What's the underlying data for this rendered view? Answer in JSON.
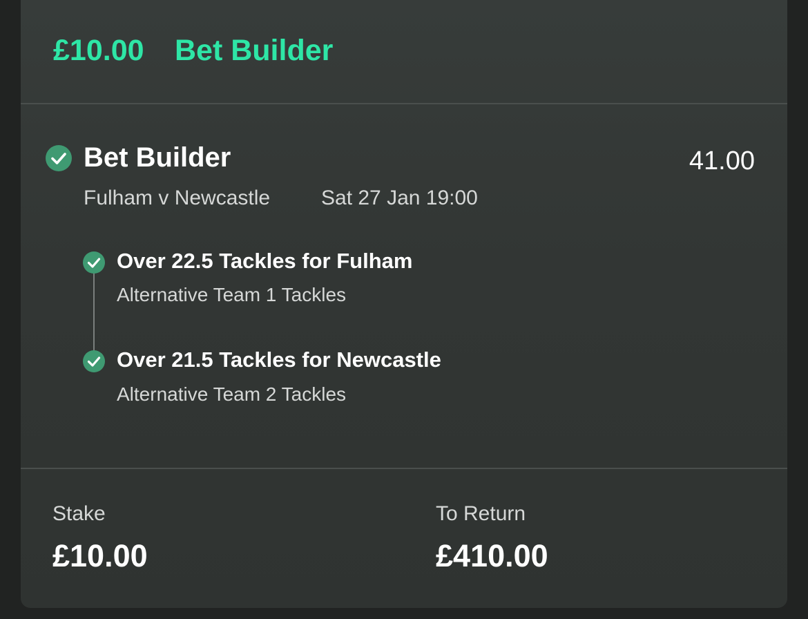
{
  "header": {
    "amount": "£10.00",
    "bet_type": "Bet Builder"
  },
  "selection": {
    "title": "Bet Builder",
    "odds": "41.00",
    "match": "Fulham v Newcastle",
    "datetime": "Sat 27 Jan 19:00",
    "status_icon": "check-circle-icon",
    "legs": [
      {
        "title": "Over 22.5 Tackles for Fulham",
        "market": "Alternative Team 1 Tackles",
        "status_icon": "check-circle-icon"
      },
      {
        "title": "Over 21.5 Tackles for Newcastle",
        "market": "Alternative Team 2 Tackles",
        "status_icon": "check-circle-icon"
      }
    ]
  },
  "footer": {
    "stake_label": "Stake",
    "stake_value": "£10.00",
    "return_label": "To Return",
    "return_value": "£410.00"
  },
  "colors": {
    "accent": "#2ee6a6",
    "check": "#3f9a72",
    "card_background": "#343836",
    "page_background": "#212322"
  }
}
